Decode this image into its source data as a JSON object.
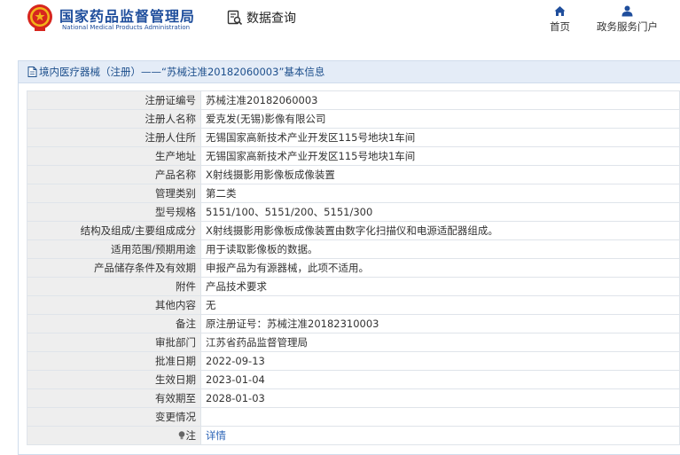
{
  "header": {
    "org_name_cn": "国家药品监督管理局",
    "org_name_en": "National Medical Products Administration",
    "data_query": "数据查询",
    "nav": [
      {
        "label": "首页",
        "icon": "home-icon"
      },
      {
        "label": "政务服务门户",
        "icon": "user-icon"
      }
    ]
  },
  "panel": {
    "title": "境内医疗器械（注册）——“苏械注准20182060003”基本信息"
  },
  "records": [
    {
      "label": "注册证编号",
      "value": "苏械注准20182060003"
    },
    {
      "label": "注册人名称",
      "value": "爱克发(无锡)影像有限公司"
    },
    {
      "label": "注册人住所",
      "value": "无锡国家高新技术产业开发区115号地块1车间"
    },
    {
      "label": "生产地址",
      "value": "无锡国家高新技术产业开发区115号地块1车间"
    },
    {
      "label": "产品名称",
      "value": "X射线摄影用影像板成像装置"
    },
    {
      "label": "管理类别",
      "value": "第二类"
    },
    {
      "label": "型号规格",
      "value": "5151/100、5151/200、5151/300"
    },
    {
      "label": "结构及组成/主要组成成分",
      "value": "X射线摄影用影像板成像装置由数字化扫描仪和电源适配器组成。"
    },
    {
      "label": "适用范围/预期用途",
      "value": "用于读取影像板的数据。"
    },
    {
      "label": "产品储存条件及有效期",
      "value": "申报产品为有源器械，此项不适用。"
    },
    {
      "label": "附件",
      "value": "产品技术要求"
    },
    {
      "label": "其他内容",
      "value": "无"
    },
    {
      "label": "备注",
      "value": "原注册证号：苏械注准20182310003"
    },
    {
      "label": "审批部门",
      "value": "江苏省药品监督管理局"
    },
    {
      "label": "批准日期",
      "value": "2022-09-13"
    },
    {
      "label": "生效日期",
      "value": "2023-01-04"
    },
    {
      "label": "有效期至",
      "value": "2028-01-03"
    },
    {
      "label": "变更情况",
      "value": ""
    }
  ],
  "note": {
    "label": "注",
    "link": "详情",
    "icon": "lightbulb-icon"
  },
  "colors": {
    "brand_blue": "#1f4e9c",
    "logo_red": "#d7261e",
    "logo_gold": "#f2b51a",
    "link": "#2a63b6"
  }
}
